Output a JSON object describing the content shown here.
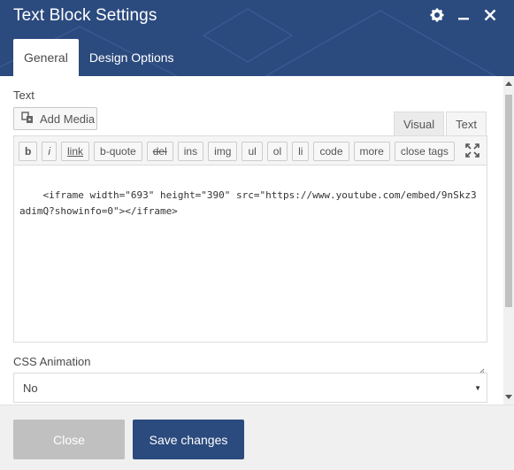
{
  "window": {
    "title": "Text Block Settings",
    "header_color": "#2b4a7e",
    "icons": [
      "gear-icon",
      "minimize-icon",
      "close-icon"
    ]
  },
  "tabs": [
    {
      "label": "General",
      "active": true
    },
    {
      "label": "Design Options",
      "active": false
    }
  ],
  "text_field": {
    "label": "Text",
    "add_media_label": "Add Media",
    "mode_tabs": [
      "Visual",
      "Text"
    ],
    "active_mode": "Text",
    "toolbar_buttons": [
      "b",
      "i",
      "link",
      "b-quote",
      "del",
      "ins",
      "img",
      "ul",
      "ol",
      "li",
      "code",
      "more",
      "close tags"
    ],
    "content": "<iframe width=\"693\" height=\"390\" src=\"https://www.youtube.com/embed/9nSkz3adimQ?showinfo=0\"></iframe>"
  },
  "css_animation": {
    "label": "CSS Animation",
    "value": "No"
  },
  "footer": {
    "close_label": "Close",
    "save_label": "Save changes"
  }
}
